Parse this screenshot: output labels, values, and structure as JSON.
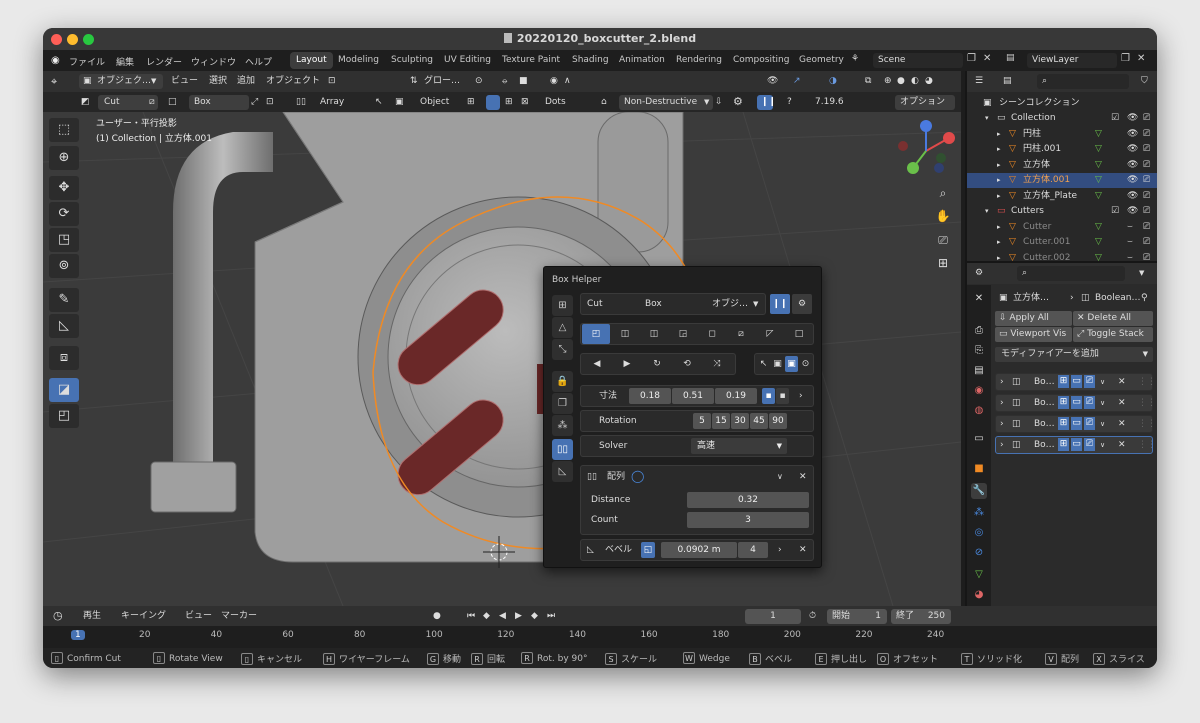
{
  "window": {
    "title": "20220120_boxcutter_2.blend"
  },
  "menu": [
    "ファイル",
    "編集",
    "レンダー",
    "ウィンドウ",
    "ヘルプ"
  ],
  "workspaces": [
    "Layout",
    "Modeling",
    "Sculpting",
    "UV Editing",
    "Texture Paint",
    "Shading",
    "Animation",
    "Rendering",
    "Compositing",
    "Geometry"
  ],
  "active_workspace": "Layout",
  "scene": {
    "name": "Scene",
    "view_layer": "ViewLayer"
  },
  "header": {
    "mode": "オブジェク…",
    "view": "ビュー",
    "select": "選択",
    "add": "追加",
    "object": "オブジェクト",
    "transform": "グロー…"
  },
  "tool_header": {
    "cut": "Cut",
    "box": "Box",
    "array": "Array",
    "object": "Object",
    "dots": "Dots",
    "mode": "Non-Destructive",
    "version": "7.19.6",
    "options": "オプション"
  },
  "viewport": {
    "projection": "ユーザー・平行投影",
    "collection_info": "(1) Collection | 立方体.001"
  },
  "box_helper": {
    "title": "Box Helper",
    "cut": "Cut",
    "box": "Box",
    "object": "オブジ…",
    "dimensions_label": "寸法",
    "dimensions": [
      "0.18",
      "0.51",
      "0.19"
    ],
    "rotation_label": "Rotation",
    "rotation_values": [
      "5",
      "15",
      "30",
      "45",
      "90"
    ],
    "solver_label": "Solver",
    "solver_value": "高速",
    "array_label": "配列",
    "distance_label": "Distance",
    "distance_value": "0.32",
    "count_label": "Count",
    "count_value": "3",
    "bevel_label": "ベベル",
    "bevel_width": "0.0902 m",
    "bevel_segments": "4"
  },
  "outliner": {
    "scene_collection": "シーンコレクション",
    "items": [
      {
        "name": "Collection",
        "indent": 0,
        "type": "collection"
      },
      {
        "name": "円柱",
        "indent": 1,
        "type": "mesh"
      },
      {
        "name": "円柱.001",
        "indent": 1,
        "type": "mesh"
      },
      {
        "name": "立方体",
        "indent": 1,
        "type": "mesh"
      },
      {
        "name": "立方体.001",
        "indent": 1,
        "type": "mesh",
        "selected": true
      },
      {
        "name": "立方体_Plate",
        "indent": 1,
        "type": "mesh"
      },
      {
        "name": "Cutters",
        "indent": 0,
        "type": "collection"
      },
      {
        "name": "Cutter",
        "indent": 1,
        "type": "mesh",
        "dim": true
      },
      {
        "name": "Cutter.001",
        "indent": 1,
        "type": "mesh",
        "dim": true
      },
      {
        "name": "Cutter.002",
        "indent": 1,
        "type": "mesh",
        "dim": true
      }
    ]
  },
  "properties": {
    "object_name": "立方体…",
    "modifier_name": "Boolean…",
    "apply_all": "Apply All",
    "delete_all": "Delete All",
    "viewport_vis": "Viewport Vis",
    "toggle_stack": "Toggle Stack",
    "add_modifier": "モディファイアーを追加",
    "modifiers": [
      "Bo…",
      "Bo…",
      "Bo…",
      "Bo…"
    ]
  },
  "timeline": {
    "playback": "再生",
    "keying": "キーイング",
    "view": "ビュー",
    "marker": "マーカー",
    "current_frame": "1",
    "start_label": "開始",
    "start": "1",
    "end_label": "終了",
    "end": "250",
    "ticks": [
      "1",
      "20",
      "40",
      "60",
      "80",
      "100",
      "120",
      "140",
      "160",
      "180",
      "200",
      "220",
      "240"
    ]
  },
  "status": [
    {
      "key": "",
      "label": "Confirm Cut"
    },
    {
      "key": "",
      "label": "Rotate View"
    },
    {
      "key": "",
      "label": "キャンセル"
    },
    {
      "key": "H",
      "label": "ワイヤーフレーム"
    },
    {
      "key": "G",
      "label": "移動"
    },
    {
      "key": "R",
      "label": "回転"
    },
    {
      "key": "R",
      "label": "Rot. by 90°"
    },
    {
      "key": "S",
      "label": "スケール"
    },
    {
      "key": "W",
      "label": "Wedge"
    },
    {
      "key": "B",
      "label": "ベベル"
    },
    {
      "key": "E",
      "label": "押し出し"
    },
    {
      "key": "O",
      "label": "オフセット"
    },
    {
      "key": "T",
      "label": "ソリッド化"
    },
    {
      "key": "V",
      "label": "配列"
    },
    {
      "key": "X",
      "label": "スライス"
    }
  ],
  "colors": {
    "accent": "#4772b3",
    "selection": "#f08a24",
    "cut_red": "#7a2a2a"
  }
}
